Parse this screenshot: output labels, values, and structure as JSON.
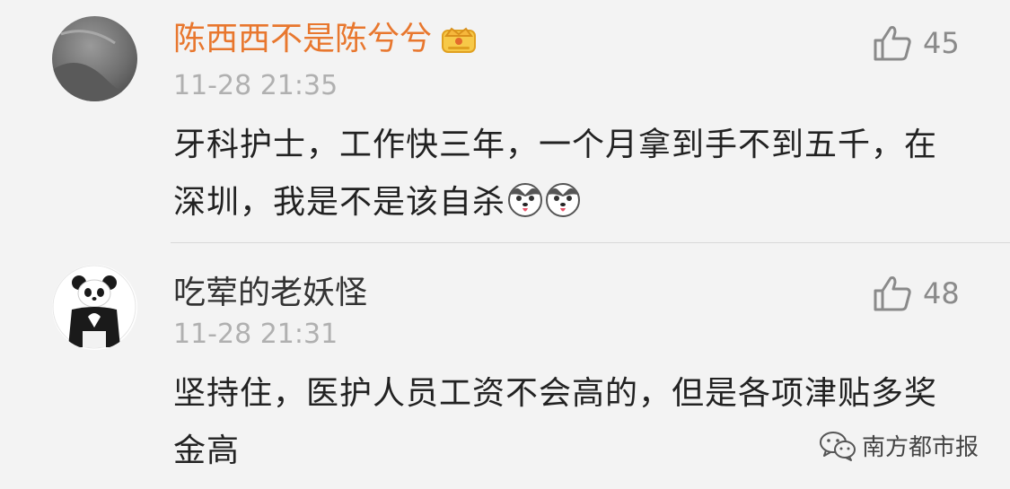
{
  "comments": [
    {
      "username": "陈西西不是陈兮兮",
      "badge_icon": "crown-icon",
      "timestamp": "11-28 21:35",
      "like_count": "45",
      "text": "牙科护士，工作快三年，一个月拿到手不到五千，在深圳，我是不是该自杀",
      "emojis": [
        "husky-emoji",
        "husky-emoji"
      ]
    },
    {
      "username": "吃荤的老妖怪",
      "timestamp": "11-28 21:31",
      "like_count": "48",
      "text": "坚持住，医护人员工资不会高的，但是各项津贴多奖金高"
    }
  ],
  "watermark": {
    "icon": "wechat-icon",
    "label": "南方都市报"
  },
  "colors": {
    "background": "#f3f3f3",
    "vip_username": "#e8772e",
    "username": "#333333",
    "timestamp": "#b0b0b0",
    "like": "#8a8a8a"
  }
}
